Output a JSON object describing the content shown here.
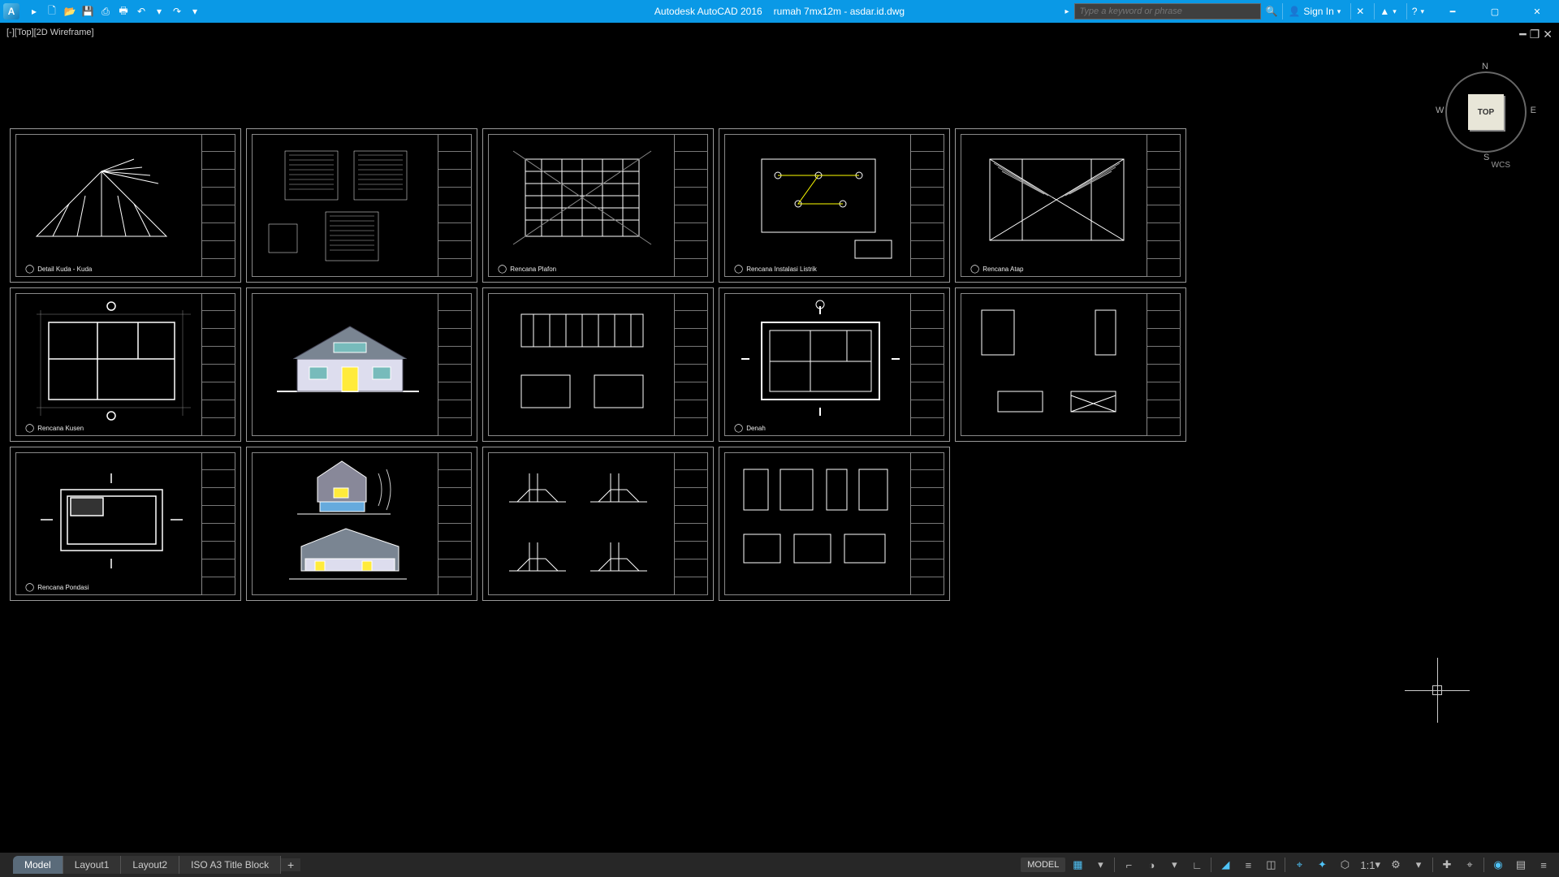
{
  "titlebar": {
    "app": "Autodesk AutoCAD 2016",
    "file": "rumah 7mx12m - asdar.id.dwg",
    "search_placeholder": "Type a keyword or phrase",
    "signin": "Sign In",
    "app_icon_letter": "A"
  },
  "viewport": {
    "label": "[-][Top][2D Wireframe]"
  },
  "viewcube": {
    "face": "TOP",
    "n": "N",
    "s": "S",
    "e": "E",
    "w": "W",
    "wcs": "WCS"
  },
  "sheets": [
    {
      "label": "Detail Kuda - Kuda",
      "kind": "truss"
    },
    {
      "label": "",
      "kind": "grid4"
    },
    {
      "label": "Rencana Plafon",
      "kind": "ceiling"
    },
    {
      "label": "Rencana Instalasi Listrik",
      "kind": "electric"
    },
    {
      "label": "Rencana Atap",
      "kind": "roof"
    },
    {
      "label": "Rencana Kusen",
      "kind": "plan"
    },
    {
      "label": "",
      "kind": "facade"
    },
    {
      "label": "",
      "kind": "sections2"
    },
    {
      "label": "Denah",
      "kind": "plan2"
    },
    {
      "label": "",
      "kind": "details4"
    },
    {
      "label": "Rencana Pondasi",
      "kind": "foundation"
    },
    {
      "label": "",
      "kind": "elev2"
    },
    {
      "label": "",
      "kind": "foot4"
    },
    {
      "label": "",
      "kind": "door6"
    },
    {
      "label": "",
      "kind": "empty"
    }
  ],
  "tabs": {
    "items": [
      "Model",
      "Layout1",
      "Layout2",
      "ISO A3 Title Block"
    ],
    "active": 0,
    "add": "+"
  },
  "statusbar": {
    "mode": "MODEL",
    "scale": "1:1",
    "icons": [
      "grid",
      "dropdown",
      "snap",
      "polar",
      "osnap",
      "sep",
      "dyn",
      "lwt",
      "sep",
      "iso1",
      "iso2",
      "iso3",
      "scale",
      "gear",
      "sep",
      "plus",
      "target",
      "sep",
      "cloud",
      "layer",
      "menu"
    ]
  }
}
